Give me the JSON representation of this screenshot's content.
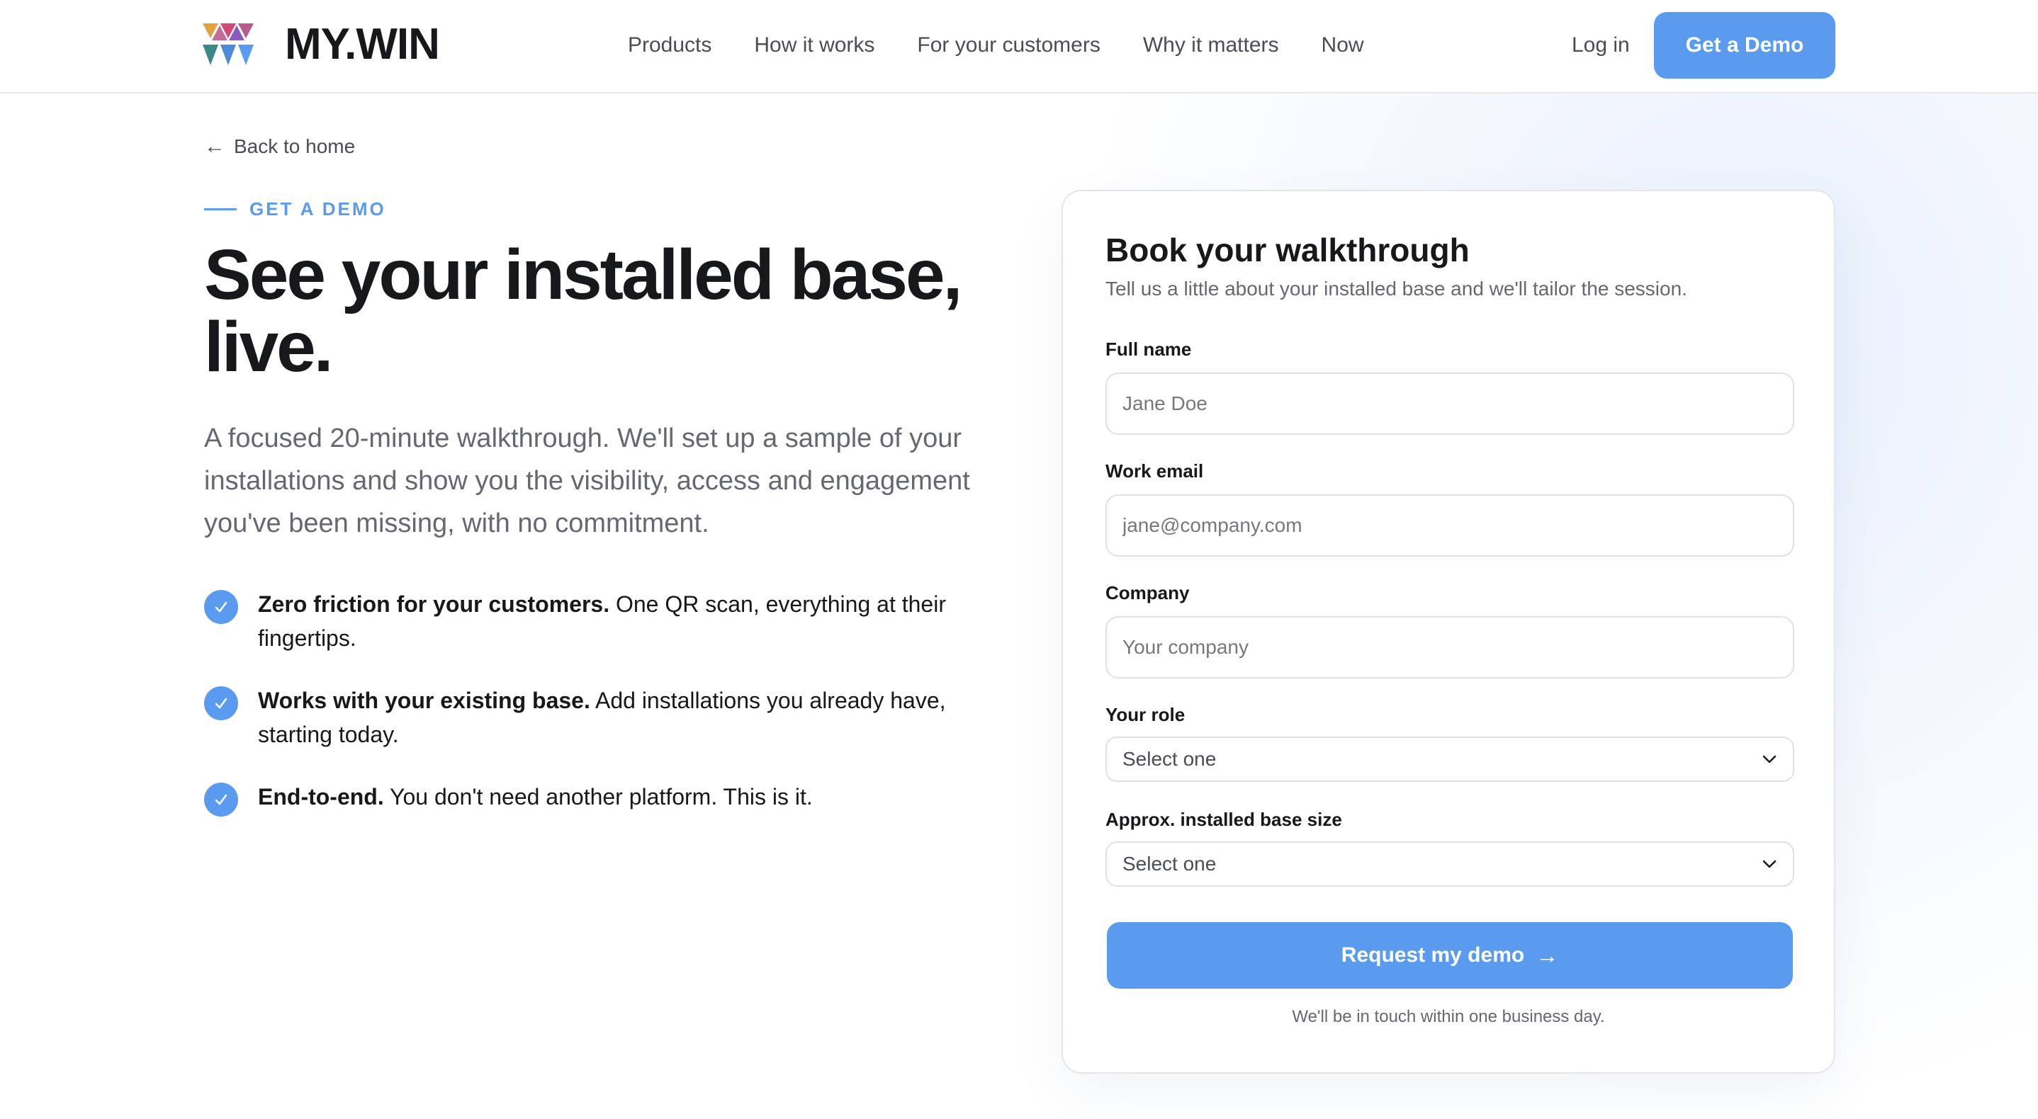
{
  "brand": {
    "name": "MY.WIN",
    "accent": "#5b9bef"
  },
  "nav": {
    "items": [
      "Products",
      "How it works",
      "For your customers",
      "Why it matters",
      "Now"
    ],
    "login": "Log in",
    "cta": "Get a Demo"
  },
  "hero": {
    "back": "Back to home",
    "eyebrow": "GET A DEMO",
    "title": "See your installed base, live.",
    "lead": "A focused 20-minute walkthrough. We'll set up a sample of your installations and show you the visibility, access and engagement you've been missing, with no commitment.",
    "features": [
      {
        "bold": "Zero friction for your customers.",
        "text": " One QR scan, everything at their fingertips."
      },
      {
        "bold": "Works with your existing base.",
        "text": " Add installations you already have, starting today."
      },
      {
        "bold": "End-to-end.",
        "text": " You don't need another platform. This is it."
      }
    ]
  },
  "form": {
    "title": "Book your walkthrough",
    "subtitle": "Tell us a little about your installed base and we'll tailor the session.",
    "full_name": {
      "label": "Full name",
      "placeholder": "Jane Doe"
    },
    "email": {
      "label": "Work email",
      "placeholder": "jane@company.com"
    },
    "company": {
      "label": "Company",
      "placeholder": "Your company"
    },
    "role": {
      "label": "Your role",
      "value": "Select one"
    },
    "base_size": {
      "label": "Approx. installed base size",
      "value": "Select one"
    },
    "submit": "Request my demo",
    "note": "We'll be in touch within one business day."
  }
}
